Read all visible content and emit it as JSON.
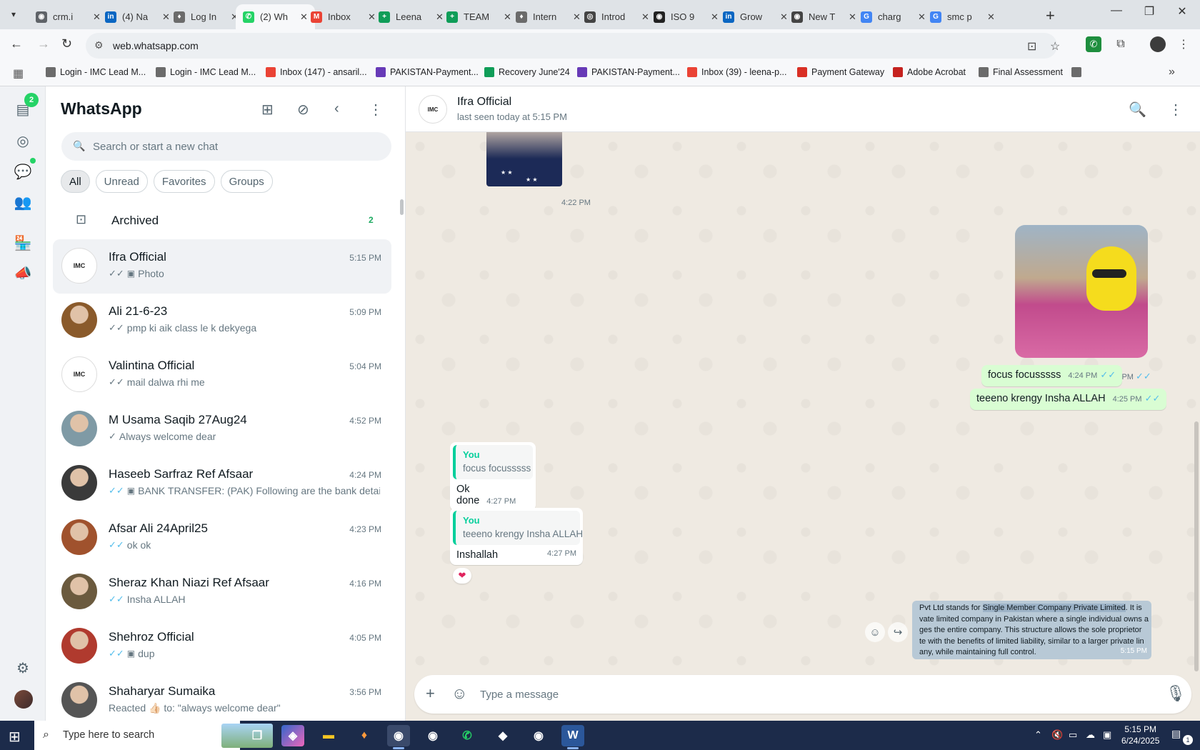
{
  "browser": {
    "tabs": [
      {
        "title": "crm.i",
        "color": "#5f6368",
        "glyph": "◉"
      },
      {
        "title": "(4) Na",
        "color": "#0a66c2",
        "glyph": "in"
      },
      {
        "title": "Log In",
        "color": "#6b6b6b",
        "glyph": "♦"
      },
      {
        "title": "(2) Wh",
        "color": "#25d366",
        "glyph": "✆"
      },
      {
        "title": "Inbox",
        "color": "#ea4335",
        "glyph": "M"
      },
      {
        "title": "Leena",
        "color": "#0f9d58",
        "glyph": "+"
      },
      {
        "title": "TEAM",
        "color": "#0f9d58",
        "glyph": "+"
      },
      {
        "title": "Intern",
        "color": "#6b6b6b",
        "glyph": "♦"
      },
      {
        "title": "Introd",
        "color": "#444",
        "glyph": "◎"
      },
      {
        "title": "ISO 9",
        "color": "#222",
        "glyph": "◉"
      },
      {
        "title": "Grow",
        "color": "#0a66c2",
        "glyph": "in"
      },
      {
        "title": "New T",
        "color": "#444",
        "glyph": "◉"
      },
      {
        "title": "charg",
        "color": "#4285f4",
        "glyph": "G"
      },
      {
        "title": "smc p",
        "color": "#4285f4",
        "glyph": "G"
      }
    ],
    "url": "web.whatsapp.com",
    "bookmarks": [
      {
        "label": "Login - IMC Lead M...",
        "color": "#6b6b6b"
      },
      {
        "label": "Login - IMC Lead M...",
        "color": "#6b6b6b"
      },
      {
        "label": "Inbox (147) - ansaril...",
        "color": "#ea4335"
      },
      {
        "label": "PAKISTAN-Payment...",
        "color": "#673ab7"
      },
      {
        "label": "Recovery June'24",
        "color": "#0f9d58"
      },
      {
        "label": "PAKISTAN-Payment...",
        "color": "#673ab7"
      },
      {
        "label": "Inbox (39) - leena-p...",
        "color": "#ea4335"
      },
      {
        "label": "Payment Gateway",
        "color": "#d93025"
      },
      {
        "label": "Adobe Acrobat",
        "color": "#c5221f"
      },
      {
        "label": "Final Assessment",
        "color": "#6b6b6b"
      }
    ]
  },
  "rail": {
    "chats_badge": "2",
    "icons": [
      "chats-icon",
      "status-icon",
      "channels-icon",
      "communities-icon",
      "business-tools-icon",
      "advertise-icon"
    ]
  },
  "sidebar": {
    "title": "WhatsApp",
    "search_placeholder": "Search or start a new chat",
    "filters": [
      "All",
      "Unread",
      "Favorites",
      "Groups"
    ],
    "archived_label": "Archived",
    "archived_count": "2",
    "chats": [
      {
        "name": "Ifra Official",
        "time": "5:15 PM",
        "preview": "Photo",
        "tick": "double-grey",
        "photo": true,
        "avatar": "logo",
        "active": true
      },
      {
        "name": "Ali 21-6-23",
        "time": "5:09 PM",
        "preview": "pmp ki aik class le k dekyega",
        "tick": "double-grey",
        "photo": false,
        "avatar": "#8a5a2b"
      },
      {
        "name": "Valintina Official",
        "time": "5:04 PM",
        "preview": "mail dalwa rhi me",
        "tick": "double-grey",
        "photo": false,
        "avatar": "logo"
      },
      {
        "name": "M Usama Saqib 27Aug24",
        "time": "4:52 PM",
        "preview": "Always welcome dear",
        "tick": "single-grey",
        "photo": false,
        "avatar": "#7f9aa5"
      },
      {
        "name": "Haseeb Sarfraz Ref Afsaar",
        "time": "4:24 PM",
        "preview": "BANK TRANSFER: (PAK) Following are the bank detai...",
        "tick": "double-blue",
        "photo": true,
        "avatar": "#3a3a3a"
      },
      {
        "name": "Afsar Ali 24April25",
        "time": "4:23 PM",
        "preview": "ok ok",
        "tick": "double-blue",
        "photo": false,
        "avatar": "#a0522d"
      },
      {
        "name": "Sheraz Khan Niazi Ref Afsaar",
        "time": "4:16 PM",
        "preview": "Insha ALLAH",
        "tick": "double-blue",
        "photo": false,
        "avatar": "#6b5a3e"
      },
      {
        "name": "Shehroz Official",
        "time": "4:05 PM",
        "preview": "dup",
        "tick": "double-blue",
        "photo": true,
        "avatar": "#b03a2e"
      },
      {
        "name": "Shaharyar Sumaika",
        "time": "3:56 PM",
        "preview": "Reacted 👍🏻 to: \"always welcome dear\"",
        "tick": "none",
        "photo": false,
        "avatar": "#555"
      }
    ]
  },
  "chat": {
    "name": "Ifra Official",
    "status": "last seen today at 5:15 PM",
    "image_in_time": "4:22 PM",
    "image_out_time": "4:24 PM",
    "out_msg_1": "focus focusssss",
    "out_msg_1_time": "4:24 PM",
    "out_msg_2": "teeeno krengy Insha ALLAH",
    "out_msg_2_time": "4:25 PM",
    "reply_1": {
      "who": "You",
      "quoted": "focus focusssss",
      "text": "Ok done",
      "time": "4:27 PM"
    },
    "reply_2": {
      "who": "You",
      "quoted": "teeeno krengy Insha ALLAH",
      "text": "Inshallah",
      "time": "4:27 PM",
      "reaction": "❤"
    },
    "long_msg": {
      "line1_pre": "Pvt Ltd stands for ",
      "line1_hl": "Single Member Company Private Limited",
      "line1_post": ". It is",
      "line2": "vate limited company in Pakistan where a single individual owns a",
      "line3": "ges the entire company. This structure allows the sole proprietor",
      "line4": "te with the benefits of limited liability, similar to a larger private lin",
      "line5": "any, while maintaining full control.",
      "time": "5:15 PM"
    },
    "composer_placeholder": "Type a message"
  },
  "taskbar": {
    "search_placeholder": "Type here to search",
    "time": "5:15 PM",
    "date": "6/24/2025",
    "notifications": "1"
  }
}
